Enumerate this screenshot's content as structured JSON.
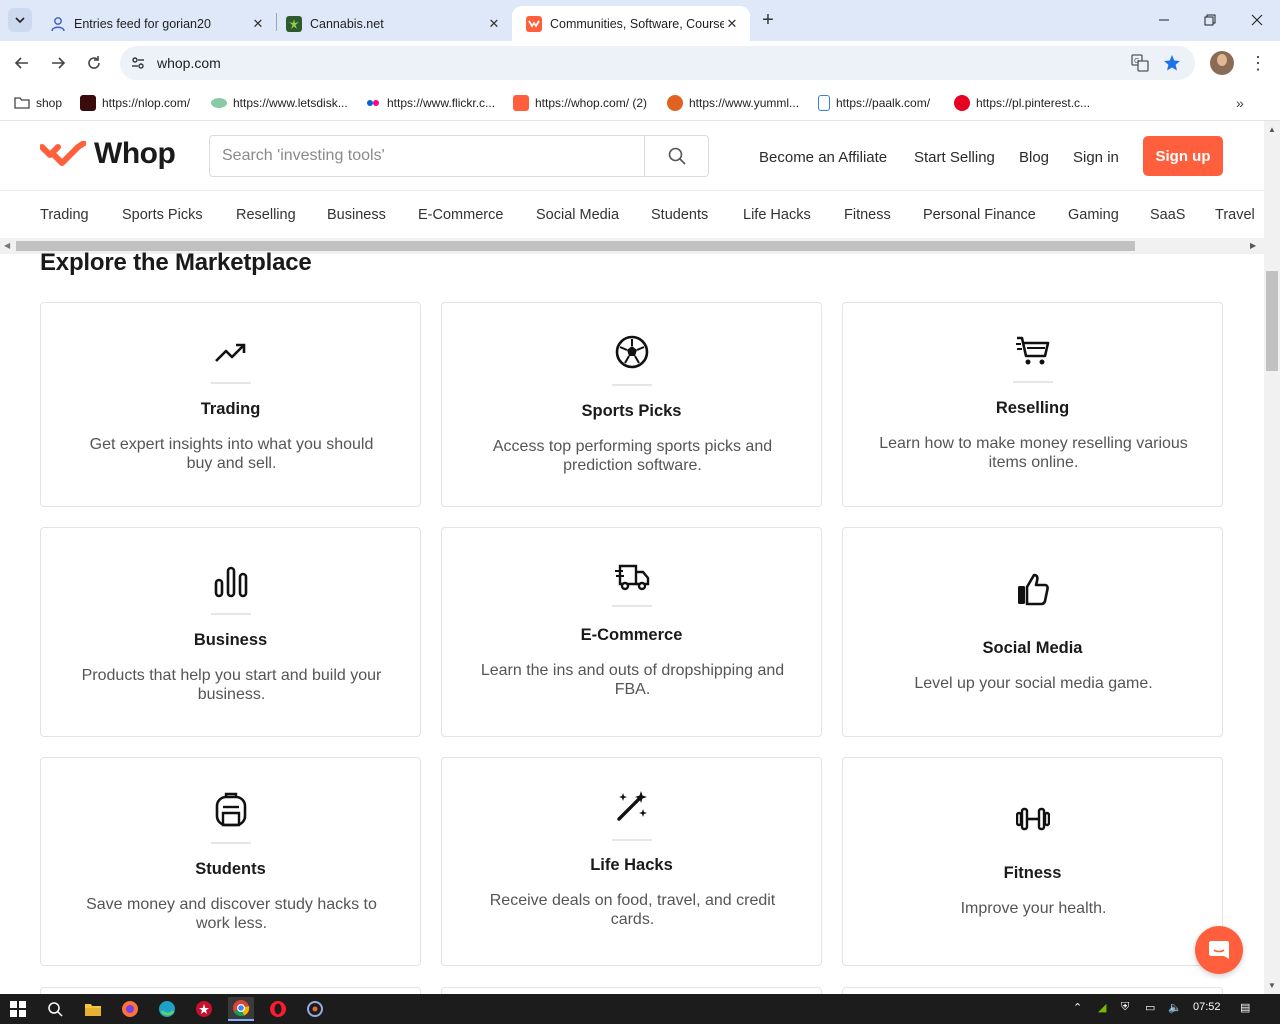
{
  "browser": {
    "tabs": [
      {
        "title": "Entries feed for gorian20",
        "favicon": "user-icon"
      },
      {
        "title": "Cannabis.net",
        "favicon": "leaf-icon"
      },
      {
        "title": "Communities, Software, Course",
        "favicon": "whop-icon"
      }
    ],
    "address": "whop.com",
    "bookmarks": [
      {
        "label": "shop",
        "icon": "folder-icon"
      },
      {
        "label": "https://nlop.com/",
        "icon": "nlop-icon"
      },
      {
        "label": "https://www.letsdisk...",
        "icon": "letsdisk-icon"
      },
      {
        "label": "https://www.flickr.c...",
        "icon": "flickr-icon"
      },
      {
        "label": "https://whop.com/ (2)",
        "icon": "whop-icon"
      },
      {
        "label": "https://www.yumml...",
        "icon": "yummly-icon"
      },
      {
        "label": "https://paalk.com/",
        "icon": "paalk-icon"
      },
      {
        "label": "https://pl.pinterest.c...",
        "icon": "pinterest-icon"
      }
    ]
  },
  "site": {
    "logo": "Whop",
    "search_placeholder": "Search 'investing tools'",
    "header_links": {
      "affiliate": "Become an Affiliate",
      "start_selling": "Start Selling",
      "blog": "Blog",
      "sign_in": "Sign in",
      "sign_up": "Sign up"
    },
    "categories": [
      "Trading",
      "Sports Picks",
      "Reselling",
      "Business",
      "E-Commerce",
      "Social Media",
      "Students",
      "Life Hacks",
      "Fitness",
      "Personal Finance",
      "Gaming",
      "SaaS",
      "Travel"
    ],
    "section_title": "Explore the Marketplace",
    "cards": [
      {
        "title": "Trading",
        "desc": "Get expert insights into what you should buy and sell.",
        "icon": "trending-up-icon"
      },
      {
        "title": "Sports Picks",
        "desc": "Access top performing sports picks and prediction software.",
        "icon": "soccer-ball-icon"
      },
      {
        "title": "Reselling",
        "desc": "Learn how to make money reselling various items online.",
        "icon": "shopping-cart-icon"
      },
      {
        "title": "Business",
        "desc": "Products that help you start and build your business.",
        "icon": "bar-chart-icon"
      },
      {
        "title": "E-Commerce",
        "desc": "Learn the ins and outs of dropshipping and FBA.",
        "icon": "delivery-truck-icon"
      },
      {
        "title": "Social Media",
        "desc": "Level up your social media game.",
        "icon": "thumbs-up-icon"
      },
      {
        "title": "Students",
        "desc": "Save money and discover study hacks to work less.",
        "icon": "backpack-icon"
      },
      {
        "title": "Life Hacks",
        "desc": "Receive deals on food, travel, and credit cards.",
        "icon": "magic-wand-icon"
      },
      {
        "title": "Fitness",
        "desc": "Improve your health.",
        "icon": "dumbbell-icon"
      }
    ],
    "accent_color": "#ff5f3c"
  },
  "taskbar": {
    "time": "07:52"
  }
}
